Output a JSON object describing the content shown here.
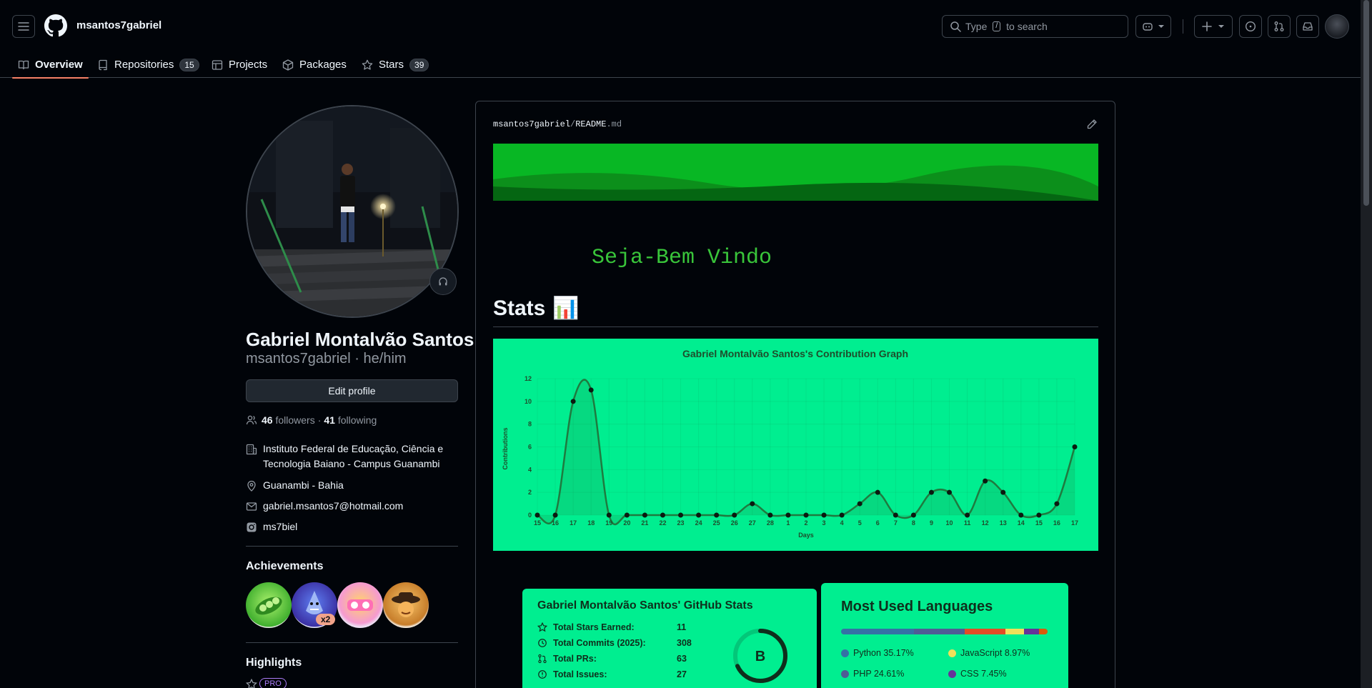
{
  "header": {
    "context_user": "msantos7gabriel",
    "search_placeholder_pre": "Type",
    "search_key": "/",
    "search_placeholder_post": "to search"
  },
  "tabs": [
    {
      "label": "Overview",
      "count": ""
    },
    {
      "label": "Repositories",
      "count": "15"
    },
    {
      "label": "Projects",
      "count": ""
    },
    {
      "label": "Packages",
      "count": ""
    },
    {
      "label": "Stars",
      "count": "39"
    }
  ],
  "profile": {
    "full_name": "Gabriel Montalvão Santos",
    "login_pronouns": "msantos7gabriel · he/him",
    "edit_button": "Edit profile",
    "followers_count": "46",
    "followers_label": "followers",
    "separator": "·",
    "following_count": "41",
    "following_label": "following",
    "organization": "Instituto Federal de Educação, Ciência e Tecnologia Baiano - Campus Guanambi",
    "location": "Guanambi - Bahia",
    "email": "gabriel.msantos7@hotmail.com",
    "social": "ms7biel"
  },
  "achievements": {
    "title": "Achievements",
    "multiplier": "x2",
    "badges": [
      "pair-extraordinaire",
      "pull-shark",
      "yolo",
      "quickdraw"
    ]
  },
  "highlights": {
    "title": "Highlights",
    "pro_label": "PRO"
  },
  "readme": {
    "path_user": "msantos7gabriel",
    "path_sep": "/",
    "path_file": "README",
    "path_ext": ".md",
    "typing_text": "Seja-Bem Vindo",
    "stats_heading": "Stats",
    "stats_emoji": "📊"
  },
  "colors": {
    "accent_tab": "#f78166",
    "card_bg": "#00ee90",
    "line_color": "#1f7a3f"
  },
  "chart_data": {
    "type": "area",
    "title": "Gabriel Montalvão Santos's Contribution Graph",
    "xlabel": "Days",
    "ylabel": "Contributions",
    "x": [
      "15",
      "16",
      "17",
      "18",
      "19",
      "20",
      "21",
      "22",
      "23",
      "24",
      "25",
      "26",
      "27",
      "28",
      "1",
      "2",
      "3",
      "4",
      "5",
      "6",
      "7",
      "8",
      "9",
      "10",
      "11",
      "12",
      "13",
      "14",
      "15",
      "16",
      "17"
    ],
    "values": [
      0,
      0,
      10,
      11,
      0,
      0,
      0,
      0,
      0,
      0,
      0,
      0,
      1,
      0,
      0,
      0,
      0,
      0,
      1,
      2,
      0,
      0,
      2,
      2,
      0,
      3,
      2,
      0,
      0,
      1,
      6
    ],
    "ylim": [
      0,
      12
    ],
    "yticks": [
      0,
      2,
      4,
      6,
      8,
      10,
      12
    ],
    "grid": true
  },
  "github_stats": {
    "title": "Gabriel Montalvão Santos' GitHub Stats",
    "rows": [
      {
        "label": "Total Stars Earned:",
        "value": "11",
        "icon": "star-icon"
      },
      {
        "label": "Total Commits (2025):",
        "value": "308",
        "icon": "history-icon"
      },
      {
        "label": "Total PRs:",
        "value": "63",
        "icon": "pull-request-icon"
      },
      {
        "label": "Total Issues:",
        "value": "27",
        "icon": "issue-icon"
      }
    ],
    "grade": "B"
  },
  "languages": {
    "title": "Most Used Languages",
    "items": [
      {
        "name": "Python 35.17%",
        "color": "#3572A5",
        "share": 35.17
      },
      {
        "name": "JavaScript 8.97%",
        "color": "#f1e05a",
        "share": 8.97
      },
      {
        "name": "PHP 24.61%",
        "color": "#4F5D95",
        "share": 24.61
      },
      {
        "name": "CSS 7.45%",
        "color": "#663399",
        "share": 7.45
      }
    ],
    "bar_segments": [
      {
        "color": "#3572A5",
        "share": 35.17
      },
      {
        "color": "#4F5D95",
        "share": 24.61
      },
      {
        "color": "#e34c26",
        "share": 19.8
      },
      {
        "color": "#f1e05a",
        "share": 8.97
      },
      {
        "color": "#663399",
        "share": 7.45
      },
      {
        "color": "#da5b0b",
        "share": 4.0
      }
    ]
  }
}
